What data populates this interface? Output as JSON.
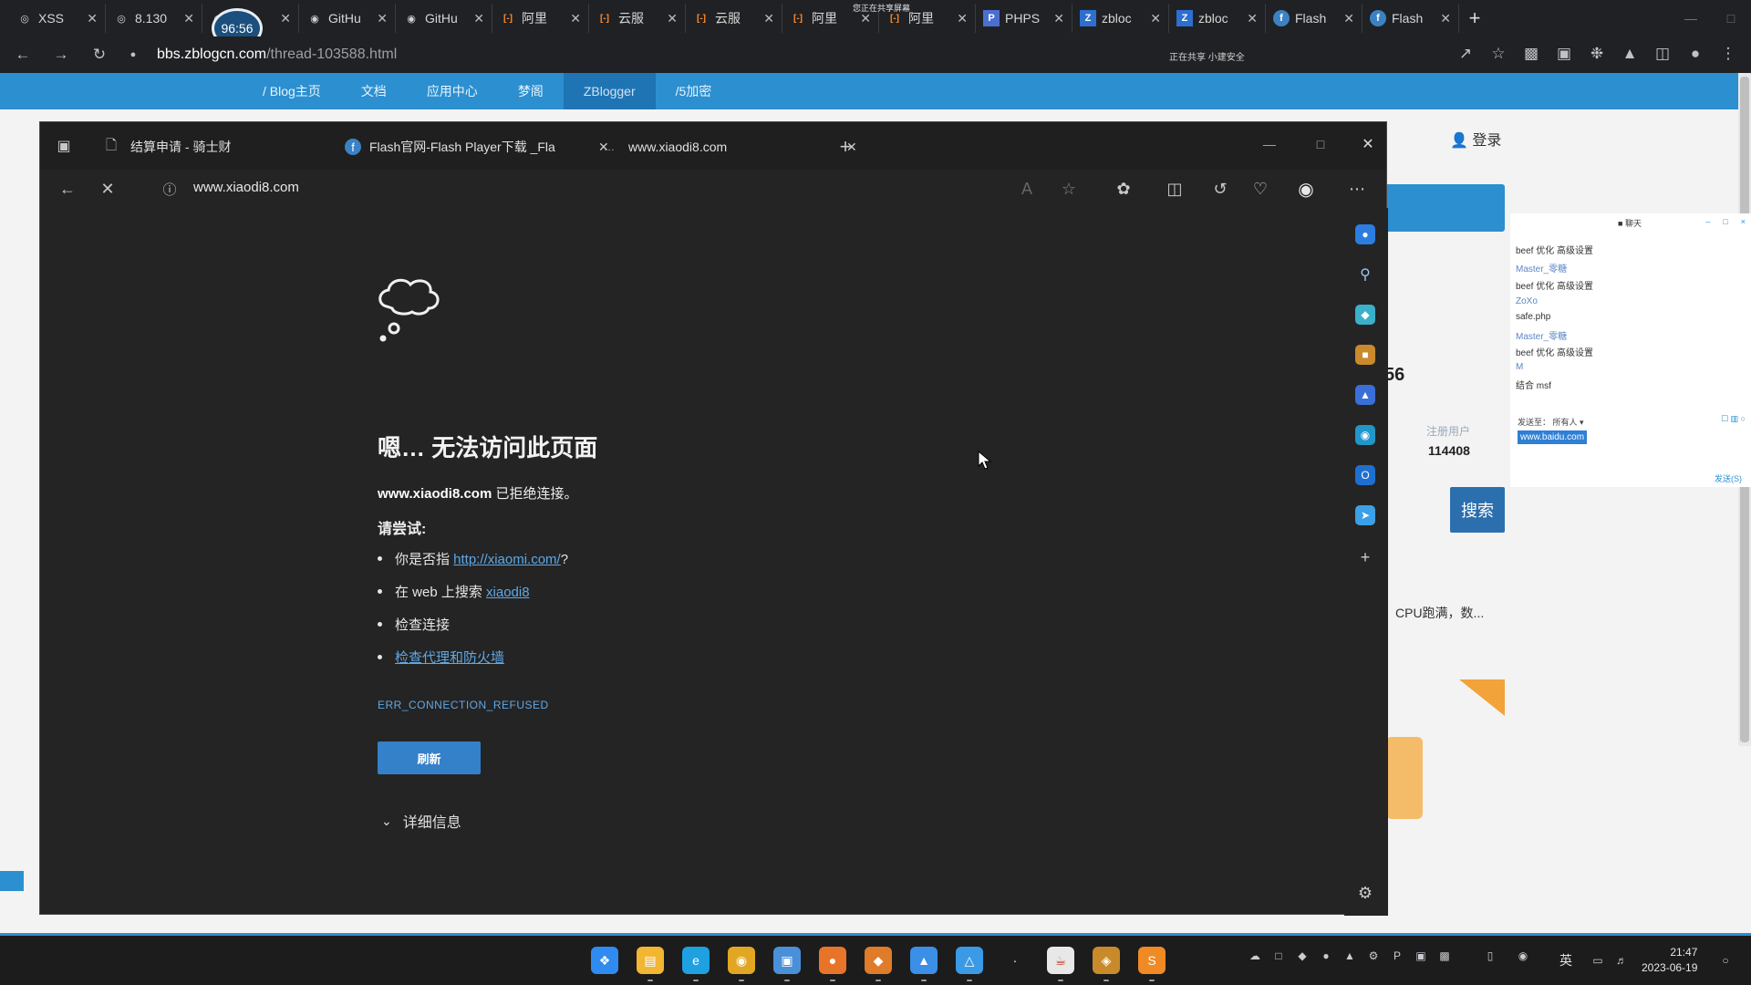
{
  "outer_browser": {
    "tabs": [
      {
        "label": "XSS",
        "icon": "globe-icon"
      },
      {
        "label": "8.130",
        "icon": "globe-icon"
      },
      {
        "label": "Gith",
        "icon": "github-icon"
      },
      {
        "label": "GitHu",
        "icon": "github-icon"
      },
      {
        "label": "GitHu",
        "icon": "github-icon"
      },
      {
        "label": "阿里",
        "icon": "aliyun-icon"
      },
      {
        "label": "云服",
        "icon": "aliyun-icon"
      },
      {
        "label": "云服",
        "icon": "aliyun-icon"
      },
      {
        "label": "阿里",
        "icon": "aliyun-icon"
      },
      {
        "label": "阿里",
        "icon": "aliyun-icon"
      },
      {
        "label": "PHPS",
        "icon": "php-icon"
      },
      {
        "label": "zbloc",
        "icon": "zblog-icon"
      },
      {
        "label": "zbloc",
        "icon": "zblog-icon"
      },
      {
        "label": "Flash",
        "icon": "flash-icon"
      },
      {
        "label": "Flash",
        "icon": "flash-icon"
      }
    ],
    "recording_time": "96:56",
    "share_notice": "您正在共享屏幕",
    "url_domain": "bbs.zblogcn.com",
    "url_path": "/thread-103588.html",
    "security_notice": "正在共享  小建安全"
  },
  "site": {
    "nav": [
      "/ Blog主页",
      "文档",
      "应用中心",
      "梦阁",
      "ZBlogger",
      "/5加密"
    ],
    "active_nav": "ZBlogger",
    "login": "登录",
    "partial_number": "56",
    "stat_label": "注册用户",
    "stat_value": "114408",
    "search_button": "搜索",
    "partial_text": "CPU跑满，数..."
  },
  "chat": {
    "title": "聊天",
    "lines": [
      {
        "text": "beef 优化 高级设置",
        "blue": false
      },
      {
        "text": "Master_零糖",
        "blue": true
      },
      {
        "text": "beef 优化 高级设置",
        "blue": false
      },
      {
        "text": "ZoXo",
        "blue": true
      },
      {
        "text": "safe.php",
        "blue": false
      },
      {
        "text": "Master_零糖",
        "blue": true
      },
      {
        "text": "beef 优化 高级设置",
        "blue": false
      },
      {
        "text": "M",
        "blue": true
      },
      {
        "text": "结合 msf",
        "blue": false
      }
    ],
    "send_to": "发送至：  所有人 ▾",
    "input_value": "www.baidu.com",
    "send_label": "发送(S)"
  },
  "edge": {
    "tabs": [
      {
        "label": "结算申请 - 骑士财",
        "icon": "page-icon"
      },
      {
        "label": "Flash官网-Flash Player下载 _Fla",
        "icon": "flash-icon"
      },
      {
        "label": "www.xiaodi8.com",
        "icon": "loading-icon"
      }
    ],
    "address": "www.xiaodi8.com",
    "error": {
      "title": "嗯… 无法访问此页面",
      "domain": "www.xiaodi8.com",
      "detail_suffix": " 已拒绝连接。",
      "try_label": "请尝试:",
      "suggestions": [
        {
          "prefix": "你是否指 ",
          "link": "http://xiaomi.com/",
          "suffix": "?"
        },
        {
          "prefix": "在 web 上搜索 ",
          "link": "xiaodi8",
          "suffix": ""
        },
        {
          "prefix": "检查连接",
          "link": "",
          "suffix": ""
        },
        {
          "prefix": "",
          "link": "检查代理和防火墙",
          "suffix": ""
        }
      ],
      "code": "ERR_CONNECTION_REFUSED",
      "refresh": "刷新",
      "details": "详细信息"
    }
  },
  "taskbar": {
    "apps": [
      "start-icon",
      "file-explorer-icon",
      "edge-icon",
      "chrome-icon",
      "remote-desktop-icon",
      "firefox-icon",
      "burpsuite-icon",
      "pin-app-icon",
      "photos-icon",
      "blank-app-icon",
      "java-icon",
      "game-icon",
      "sublime-icon"
    ],
    "lang": "英",
    "time": "21:47",
    "date": "2023-06-19"
  },
  "colors": {
    "site_blue": "#2c8fd0",
    "edge_bg": "#242424",
    "link": "#5fa8e6",
    "refresh_btn": "#3480c9"
  }
}
